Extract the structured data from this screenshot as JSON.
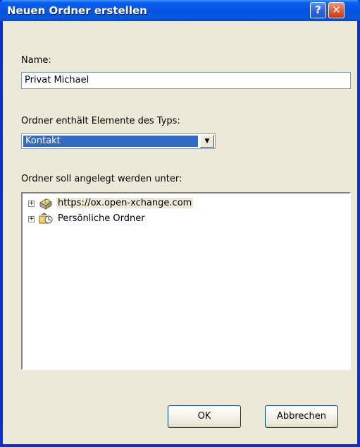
{
  "window": {
    "title": "Neuen Ordner erstellen",
    "help_glyph": "?",
    "close_glyph": "✕"
  },
  "name_label": "Name:",
  "name_value": "Privat Michael",
  "type_label": "Ordner enthält Elemente des Typs:",
  "type_value": "Kontakt",
  "location_label": "Ordner soll angelegt werden unter:",
  "tree": {
    "items": [
      {
        "label": "https://ox.open-xchange.com",
        "icon": "server-icon",
        "selected": true
      },
      {
        "label": "Persönliche Ordner",
        "icon": "personal-folders-icon",
        "selected": false
      }
    ]
  },
  "buttons": {
    "ok": "OK",
    "cancel": "Abbrechen"
  }
}
